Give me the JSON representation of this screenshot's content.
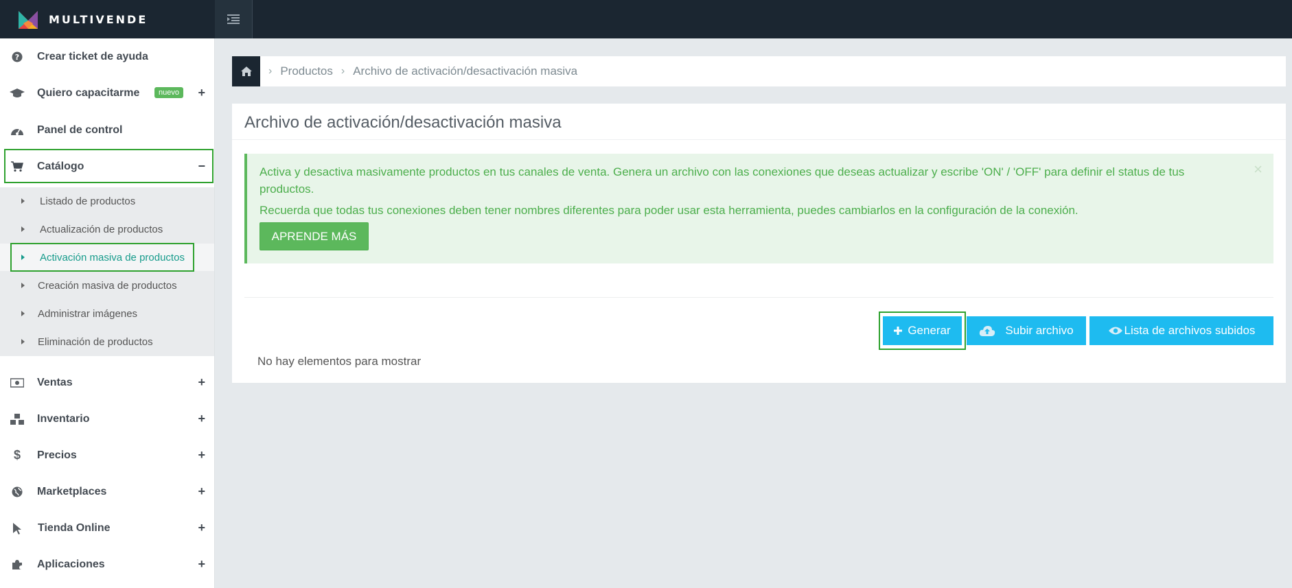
{
  "brand": {
    "name": "MULTIVENDE"
  },
  "sidebar": {
    "items": [
      {
        "label": "Crear ticket de ayuda",
        "icon": "question-circle-icon"
      },
      {
        "label": "Quiero capacitarme",
        "icon": "graduation-cap-icon",
        "badge": "nuevo",
        "expander": "+"
      },
      {
        "label": "Panel de control",
        "icon": "dashboard-icon"
      },
      {
        "label": "Catálogo",
        "icon": "shopping-cart-icon",
        "expander": "−"
      },
      {
        "label": "Ventas",
        "icon": "money-icon",
        "expander": "+"
      },
      {
        "label": "Inventario",
        "icon": "cubes-icon",
        "expander": "+"
      },
      {
        "label": "Precios",
        "icon": "dollar-icon",
        "expander": "+"
      },
      {
        "label": "Marketplaces",
        "icon": "globe-icon",
        "expander": "+"
      },
      {
        "label": "Tienda Online",
        "icon": "pointer-icon",
        "expander": "+"
      },
      {
        "label": "Aplicaciones",
        "icon": "puzzle-icon",
        "expander": "+"
      }
    ],
    "catalog_submenu": [
      {
        "label": "Listado de productos"
      },
      {
        "label": "Actualización de productos"
      },
      {
        "label": "Activación masiva de productos",
        "active": true
      },
      {
        "label": "Creación masiva de productos"
      },
      {
        "label": "Administrar imágenes"
      },
      {
        "label": "Eliminación de productos"
      }
    ]
  },
  "breadcrumb": {
    "home_icon": "home-icon",
    "items": [
      "Productos",
      "Archivo de activación/desactivación masiva"
    ]
  },
  "panel": {
    "title": "Archivo de activación/desactivación masiva",
    "alert": {
      "line1": "Activa y desactiva masivamente productos en tus canales de venta. Genera un archivo con las conexiones que deseas actualizar y escribe 'ON' / 'OFF' para definir el status de tus productos.",
      "line2": "Recuerda que todas tus conexiones deben tener nombres diferentes para poder usar esta herramienta, puedes cambiarlos en la configuración de la conexión.",
      "button": "APRENDE MÁS",
      "close": "×"
    },
    "buttons": {
      "generate": "Generar",
      "upload": "Subir archivo",
      "list": "Lista de archivos subidos"
    },
    "empty_message": "No hay elementos para mostrar"
  },
  "colors": {
    "topbar": "#1b2631",
    "accent_green": "#5cb85c",
    "button_blue": "#1ebbf0",
    "active_teal": "#169b8b",
    "highlight_box": "#2ea12e"
  }
}
